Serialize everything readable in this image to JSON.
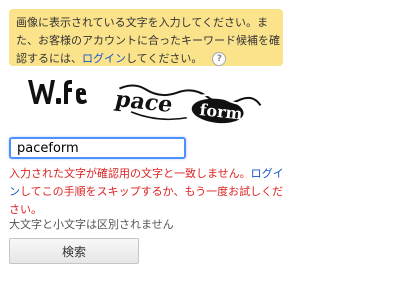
{
  "notice": {
    "line1": "画像に表示されている文字を入力してください。ま",
    "line2": "た、お客様のアカウントに合ったキーワード候補を確",
    "line3_before": "認するには、",
    "login_link": "ログイン",
    "line3_after": "してください。",
    "help_icon": "?",
    "background": "#fbe38b"
  },
  "captcha": {
    "icon": "distorted-text-captcha-image"
  },
  "answer_input": {
    "value": "paceform"
  },
  "error": {
    "line1_before": "入力された文字が確認用の文字と一致しません。",
    "line1_link": "ログイ",
    "line2_link": "ン",
    "line2_after": "してこの手順をスキップするか、もう一度お試しくだ",
    "line3": "さい。",
    "color": "#dd2222"
  },
  "case_note": "大文字と小文字は区別されません",
  "search_button": {
    "label": "検索"
  },
  "colors": {
    "link": "#1155cc",
    "focus": "#4d90fe"
  }
}
